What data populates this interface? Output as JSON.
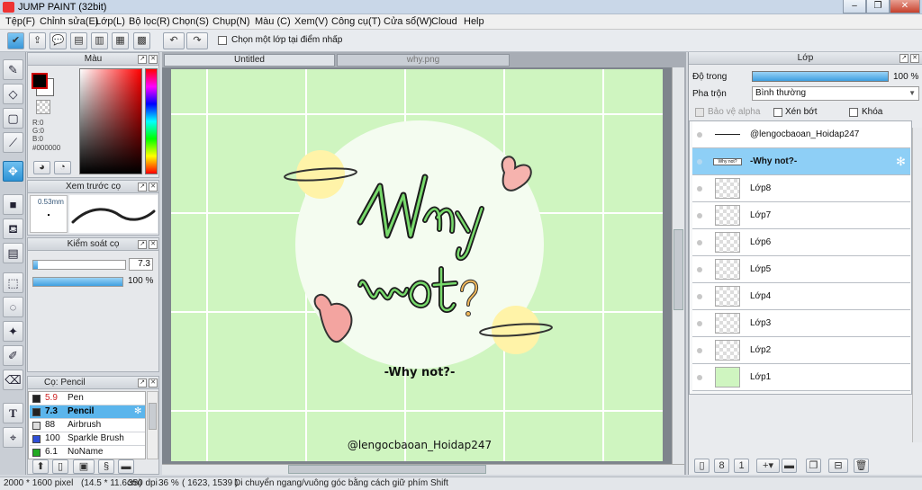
{
  "window": {
    "title": "JUMP PAINT (32bit)"
  },
  "menu": [
    "Tệp(F)",
    "Chỉnh sửa(E)",
    "Lớp(L)",
    "Bộ lọc(R)",
    "Chọn(S)",
    "Chụp(N)",
    "Màu (C)",
    "Xem(V)",
    "Công cụ(T)",
    "Cửa sổ(W)",
    "Cloud",
    "Help"
  ],
  "toolbar": {
    "checkbox_label": "Chọn một lớp tại điểm nhấp"
  },
  "color_panel": {
    "title": "Màu",
    "r": "R:0",
    "g": "G:0",
    "b": "B:0",
    "hex": "#000000",
    "fg": "#000000",
    "bg": "#ffffff"
  },
  "brush_preview": {
    "title": "Xem trước cọ",
    "size": "0.53mm"
  },
  "brush_control": {
    "title": "Kiểm soát cọ",
    "size_value": "7.3",
    "opacity_value": "100 %",
    "size_fraction": 0.05,
    "opacity_fraction": 1.0
  },
  "brush_list": {
    "title": "Cọ: Pencil",
    "items": [
      {
        "size": "5.9",
        "name": "Pen",
        "color": "#222222"
      },
      {
        "size": "7.3",
        "name": "Pencil",
        "color": "#222222"
      },
      {
        "size": "88",
        "name": "Airbrush",
        "color": "#dddddd"
      },
      {
        "size": "100",
        "name": "Sparkle Brush",
        "color": "#2f4fd8"
      },
      {
        "size": "6.1",
        "name": "NoName",
        "color": "#22aa22"
      }
    ]
  },
  "tabs": [
    {
      "label": "Untitled"
    },
    {
      "label": "why.png"
    }
  ],
  "artwork": {
    "main_text": "-Why not?-",
    "credit": "@lengocbaoan_Hoidap247",
    "bg": "#cff5c0",
    "circle": "#f4fcf0"
  },
  "layers_panel": {
    "title": "Lớp",
    "opacity_label": "Độ trong",
    "opacity_value": "100 %",
    "blend_label": "Pha trộn",
    "blend_value": "Bình thường",
    "protect_alpha": "Bảo vệ alpha",
    "clip": "Xén bớt",
    "lock": "Khóa",
    "layers": [
      {
        "name": "@lengocbaoan_Hoidap247"
      },
      {
        "name": "-Why not?-",
        "thumb": "Why not?"
      },
      {
        "name": "Lớp8"
      },
      {
        "name": "Lớp7"
      },
      {
        "name": "Lớp6"
      },
      {
        "name": "Lớp5"
      },
      {
        "name": "Lớp4"
      },
      {
        "name": "Lớp3"
      },
      {
        "name": "Lớp2"
      },
      {
        "name": "Lớp1"
      }
    ]
  },
  "status": {
    "size": "2000 * 1600 pixel",
    "cm": "(14.5 * 11.6cm)",
    "dpi": "350 dpi",
    "zoom": "36 %",
    "coords": "( 1623, 1539 )",
    "hint": "Di chuyển ngang/vuông góc bằng cách giữ phím Shift"
  }
}
